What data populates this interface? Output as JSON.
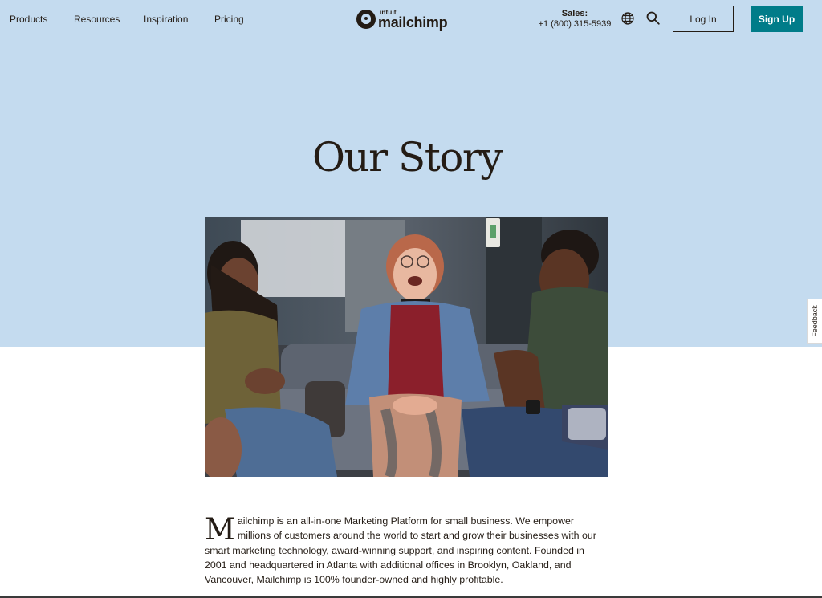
{
  "nav": {
    "links": [
      "Products",
      "Resources",
      "Inspiration",
      "Pricing"
    ]
  },
  "logo": {
    "brand_small": "intuit",
    "brand_name": "mailchimp"
  },
  "sales": {
    "label": "Sales:",
    "phone": "+1 (800) 315-5939"
  },
  "icons": {
    "globe": "globe-icon",
    "search": "search-icon"
  },
  "buttons": {
    "login": "Log In",
    "signup": "Sign Up"
  },
  "hero": {
    "title": "Our Story"
  },
  "feedback": {
    "label": "Feedback"
  },
  "story": {
    "drop_cap": "M",
    "text": "ailchimp is an all-in-one Marketing Platform for small business. We empower millions of customers around the world to start and grow their businesses with our smart marketing technology, award-winning support, and inspiring content. Founded in 2001 and headquartered in Atlanta with additional offices in Brooklyn, Oakland, and Vancouver, Mailchimp is 100% founder-owned and highly profitable."
  },
  "colors": {
    "hero_background": "#c4dbef",
    "brand_teal": "#007c89",
    "text": "#241c15"
  }
}
